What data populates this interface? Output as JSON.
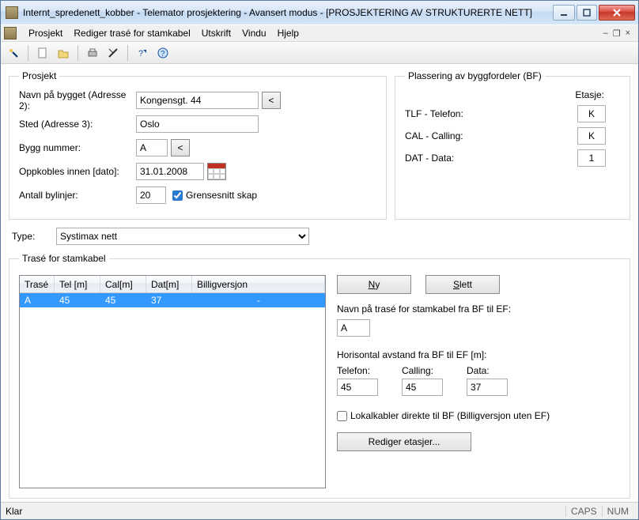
{
  "window": {
    "title": "Internt_spredenett_kobber - Telemator prosjektering - Avansert modus - [PROSJEKTERING AV STRUKTURERTE NETT]"
  },
  "menu": {
    "items": [
      "Prosjekt",
      "Rediger trasé for stamkabel",
      "Utskrift",
      "Vindu",
      "Hjelp"
    ]
  },
  "prosjekt": {
    "legend": "Prosjekt",
    "navn_label": "Navn på bygget (Adresse 2):",
    "navn_value": "Kongensgt. 44",
    "sted_label": "Sted (Adresse 3):",
    "sted_value": "Oslo",
    "bygg_label": "Bygg nummer:",
    "bygg_value": "A",
    "opp_label": "Oppkobles innen [dato]:",
    "opp_value": "31.01.2008",
    "bylinjer_label": "Antall bylinjer:",
    "bylinjer_value": "20",
    "grense_label": "Grensesnitt skap",
    "grense_checked": true
  },
  "plassering": {
    "legend": "Plassering av byggfordeler (BF)",
    "etasje": "Etasje:",
    "rows": [
      {
        "label": "TLF - Telefon:",
        "value": "K"
      },
      {
        "label": "CAL - Calling:",
        "value": "K"
      },
      {
        "label": "DAT - Data:",
        "value": "1"
      }
    ]
  },
  "type": {
    "label": "Type:",
    "value": "Systimax nett"
  },
  "trase": {
    "legend": "Trasé for stamkabel",
    "headers": [
      "Trasé",
      "Tel [m]",
      "Cal[m]",
      "Dat[m]",
      "Billigversjon"
    ],
    "rows": [
      {
        "a": "A",
        "tel": "45",
        "cal": "45",
        "dat": "37",
        "billig": "-"
      }
    ],
    "ny": "Ny",
    "slett": "Slett",
    "navn_label": "Navn på trasé for stamkabel fra BF til EF:",
    "navn_value": "A",
    "avstand_label": "Horisontal avstand fra BF til EF [m]:",
    "col_tel": "Telefon:",
    "col_cal": "Calling:",
    "col_dat": "Data:",
    "val_tel": "45",
    "val_cal": "45",
    "val_dat": "37",
    "lokal_label": "Lokalkabler direkte til BF (Billigversjon uten EF)",
    "edit": "Rediger etasjer..."
  },
  "status": {
    "left": "Klar",
    "caps": "CAPS",
    "num": "NUM"
  }
}
